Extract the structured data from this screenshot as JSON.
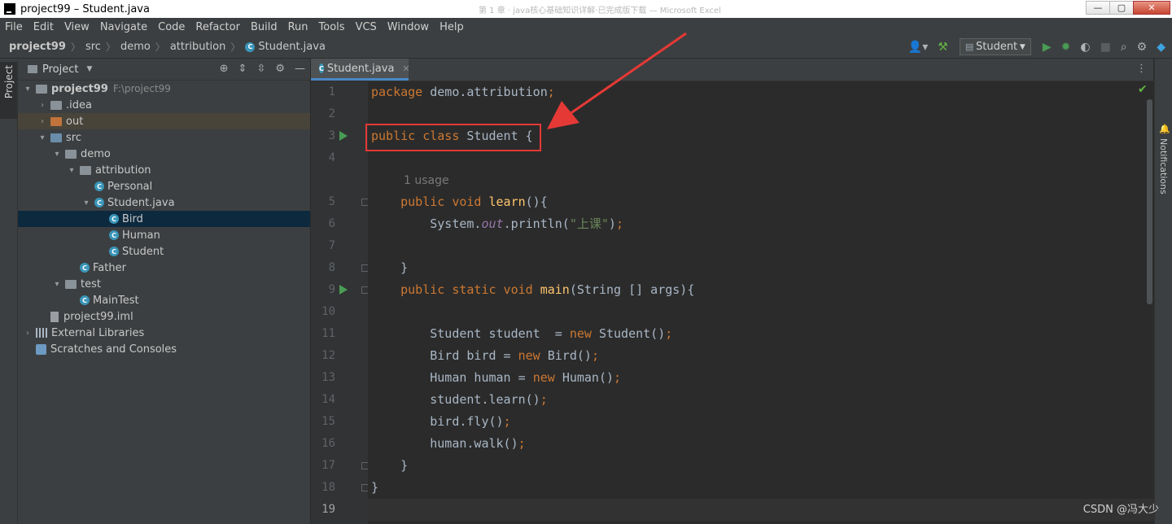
{
  "window": {
    "title": "project99 – Student.java",
    "ghost_title": "第 1 章 · java核心基础知识详解·已完成版下载 — Microsoft Excel",
    "controls": {
      "minimize": "—",
      "maximize": "▢",
      "close": "✕"
    }
  },
  "menu": [
    "File",
    "Edit",
    "View",
    "Navigate",
    "Code",
    "Refactor",
    "Build",
    "Run",
    "Tools",
    "VCS",
    "Window",
    "Help"
  ],
  "breadcrumb": {
    "project": "project99",
    "items": [
      "src",
      "demo",
      "attribution"
    ],
    "file": "Student.java"
  },
  "toolbar": {
    "run_config": "Student"
  },
  "sidebar": {
    "vertical_label": "Project"
  },
  "project_panel": {
    "title": "Project",
    "tree": [
      {
        "label": "project99",
        "hint": "F:\\project99",
        "depth": 0,
        "arrow": "▾",
        "icon": "folder",
        "bold": true
      },
      {
        "label": ".idea",
        "depth": 1,
        "arrow": "›",
        "icon": "folder"
      },
      {
        "label": "out",
        "depth": 1,
        "arrow": "›",
        "icon": "folder-orange",
        "highlight": "out"
      },
      {
        "label": "src",
        "depth": 1,
        "arrow": "▾",
        "icon": "folder-blue"
      },
      {
        "label": "demo",
        "depth": 2,
        "arrow": "▾",
        "icon": "folder"
      },
      {
        "label": "attribution",
        "depth": 3,
        "arrow": "▾",
        "icon": "folder"
      },
      {
        "label": "Personal",
        "depth": 4,
        "arrow": "",
        "icon": "class"
      },
      {
        "label": "Student.java",
        "depth": 4,
        "arrow": "▾",
        "icon": "class",
        "arrow_left": true
      },
      {
        "label": "Bird",
        "depth": 5,
        "arrow": "",
        "icon": "class",
        "selected": true
      },
      {
        "label": "Human",
        "depth": 5,
        "arrow": "",
        "icon": "class"
      },
      {
        "label": "Student",
        "depth": 5,
        "arrow": "",
        "icon": "class"
      },
      {
        "label": "Father",
        "depth": 3,
        "arrow": "",
        "icon": "class"
      },
      {
        "label": "test",
        "depth": 2,
        "arrow": "▾",
        "icon": "folder"
      },
      {
        "label": "MainTest",
        "depth": 3,
        "arrow": "",
        "icon": "class"
      },
      {
        "label": "project99.iml",
        "depth": 1,
        "arrow": "",
        "icon": "file"
      },
      {
        "label": "External Libraries",
        "depth": 0,
        "arrow": "›",
        "icon": "lib"
      },
      {
        "label": "Scratches and Consoles",
        "depth": 0,
        "arrow": "",
        "icon": "scratch"
      }
    ]
  },
  "editor": {
    "tab": "Student.java",
    "usage_hint": "1 usage",
    "current_line": 19,
    "lines": [
      {
        "n": 1,
        "tokens": [
          [
            "kw",
            "package "
          ],
          [
            "",
            "demo.attribution"
          ],
          [
            "kw",
            ";"
          ]
        ]
      },
      {
        "n": 2,
        "tokens": []
      },
      {
        "n": 3,
        "tokens": [
          [
            "kw",
            "public class "
          ],
          [
            "",
            "Student {"
          ]
        ],
        "run": true
      },
      {
        "n": 4,
        "tokens": []
      },
      {
        "usage": true
      },
      {
        "n": 5,
        "tokens": [
          [
            "",
            "    "
          ],
          [
            "kw",
            "public void "
          ],
          [
            "fn",
            "learn"
          ],
          [
            "",
            "(){"
          ]
        ],
        "fold": true
      },
      {
        "n": 6,
        "tokens": [
          [
            "",
            "        System."
          ],
          [
            "fld",
            "out"
          ],
          [
            "",
            ".println("
          ],
          [
            "str",
            "\"上课\""
          ],
          [
            "",
            ")"
          ],
          [
            "kw",
            ";"
          ]
        ]
      },
      {
        "n": 7,
        "tokens": []
      },
      {
        "n": 8,
        "tokens": [
          [
            "",
            "    }"
          ]
        ],
        "fold": true
      },
      {
        "n": 9,
        "tokens": [
          [
            "",
            "    "
          ],
          [
            "kw",
            "public static void "
          ],
          [
            "fn",
            "main"
          ],
          [
            "",
            "(String [] args){"
          ]
        ],
        "run": true,
        "fold": true
      },
      {
        "n": 10,
        "tokens": []
      },
      {
        "n": 11,
        "tokens": [
          [
            "",
            "        Student student  = "
          ],
          [
            "kw",
            "new "
          ],
          [
            "",
            "Student()"
          ],
          [
            "kw",
            ";"
          ]
        ]
      },
      {
        "n": 12,
        "tokens": [
          [
            "",
            "        Bird bird = "
          ],
          [
            "kw",
            "new "
          ],
          [
            "",
            "Bird()"
          ],
          [
            "kw",
            ";"
          ]
        ]
      },
      {
        "n": 13,
        "tokens": [
          [
            "",
            "        Human human = "
          ],
          [
            "kw",
            "new "
          ],
          [
            "",
            "Human()"
          ],
          [
            "kw",
            ";"
          ]
        ]
      },
      {
        "n": 14,
        "tokens": [
          [
            "",
            "        student.learn()"
          ],
          [
            "kw",
            ";"
          ]
        ]
      },
      {
        "n": 15,
        "tokens": [
          [
            "",
            "        bird.fly()"
          ],
          [
            "kw",
            ";"
          ]
        ]
      },
      {
        "n": 16,
        "tokens": [
          [
            "",
            "        human.walk()"
          ],
          [
            "kw",
            ";"
          ]
        ]
      },
      {
        "n": 17,
        "tokens": [
          [
            "",
            "    }"
          ]
        ],
        "fold": true
      },
      {
        "n": 18,
        "tokens": [
          [
            "",
            "}"
          ]
        ],
        "fold": true
      },
      {
        "n": 19,
        "tokens": []
      }
    ]
  },
  "right_strip": {
    "notifications_label": "Notifications"
  },
  "watermark": "CSDN @冯大少",
  "colors": {
    "keyword": "#cc7832",
    "method": "#ffc66d",
    "string": "#6a8759",
    "field": "#9876aa",
    "annotation": "#e53935"
  }
}
